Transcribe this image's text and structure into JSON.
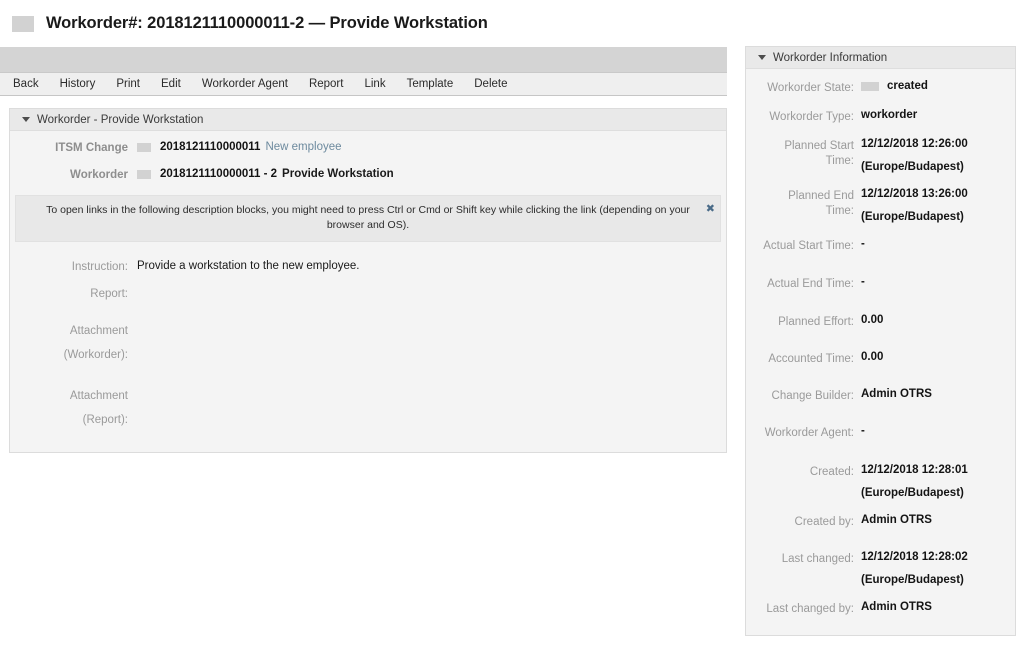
{
  "page": {
    "title": "Workorder#: 2018121110000011-2 — Provide Workstation",
    "title_icon": "broken-image-icon"
  },
  "toolbar": {
    "items": [
      {
        "label": "Back",
        "name": "back"
      },
      {
        "label": "History",
        "name": "history"
      },
      {
        "label": "Print",
        "name": "print"
      },
      {
        "label": "Edit",
        "name": "edit"
      },
      {
        "label": "Workorder Agent",
        "name": "workorder-agent"
      },
      {
        "label": "Report",
        "name": "report"
      },
      {
        "label": "Link",
        "name": "link"
      },
      {
        "label": "Template",
        "name": "template"
      },
      {
        "label": "Delete",
        "name": "delete"
      }
    ]
  },
  "main": {
    "widget_title": "Workorder - Provide Workstation",
    "itsm_change": {
      "label": "ITSM Change",
      "id": "2018121110000011",
      "link": "New employee"
    },
    "workorder": {
      "label": "Workorder",
      "id": "2018121110000011 - 2",
      "name": "Provide Workstation"
    },
    "notice": {
      "text": "To open links in the following description blocks, you might need to press Ctrl or Cmd or Shift key while clicking the link (depending on your browser and OS).",
      "close": "✖"
    },
    "fields": [
      {
        "label": "Instruction:",
        "value": "Provide a workstation to the new employee."
      },
      {
        "label": "Report:",
        "value": ""
      },
      {
        "label": "Attachment (Workorder):",
        "value": ""
      },
      {
        "label": "Attachment (Report):",
        "value": ""
      }
    ],
    "instruction_label": "Instruction:",
    "instruction_value": "Provide a workstation to the new employee.",
    "report_label": "Report:",
    "attachment_workorder_line1": "Attachment",
    "attachment_workorder_line2": "(Workorder):",
    "attachment_report_line1": "Attachment",
    "attachment_report_line2": "(Report):"
  },
  "sidebar": {
    "widget_title": "Workorder Information",
    "state": {
      "label": "Workorder State:",
      "value": "created",
      "icon": "broken-image-icon"
    },
    "type": {
      "label": "Workorder Type:",
      "value": "workorder"
    },
    "planned_start": {
      "label_line1": "Planned Start",
      "label_line2": "Time:",
      "value": "12/12/2018 12:26:00",
      "timezone": "(Europe/Budapest)"
    },
    "planned_end": {
      "label_line1": "Planned End",
      "label_line2": "Time:",
      "value": "12/12/2018 13:26:00",
      "timezone": "(Europe/Budapest)"
    },
    "actual_start": {
      "label": "Actual Start Time:",
      "value": "-"
    },
    "actual_end": {
      "label": "Actual End Time:",
      "value": "-"
    },
    "planned_effort": {
      "label": "Planned Effort:",
      "value": "0.00"
    },
    "accounted_time": {
      "label": "Accounted Time:",
      "value": "0.00"
    },
    "change_builder": {
      "label": "Change Builder:",
      "value": "Admin OTRS"
    },
    "workorder_agent": {
      "label": "Workorder Agent:",
      "value": "-"
    },
    "created": {
      "label": "Created:",
      "value": "12/12/2018 12:28:01",
      "timezone": "(Europe/Budapest)"
    },
    "created_by": {
      "label": "Created by:",
      "value": "Admin OTRS"
    },
    "last_changed": {
      "label": "Last changed:",
      "value": "12/12/2018 12:28:02",
      "timezone": "(Europe/Budapest)"
    },
    "last_changed_by": {
      "label": "Last changed by:",
      "value": "Admin OTRS"
    }
  },
  "colors": {
    "link": "#6d8a9e",
    "panel_bg": "#f4f4f4",
    "header_bg": "#e9e9e9",
    "toolbar_strip": "#d4d4d4"
  }
}
